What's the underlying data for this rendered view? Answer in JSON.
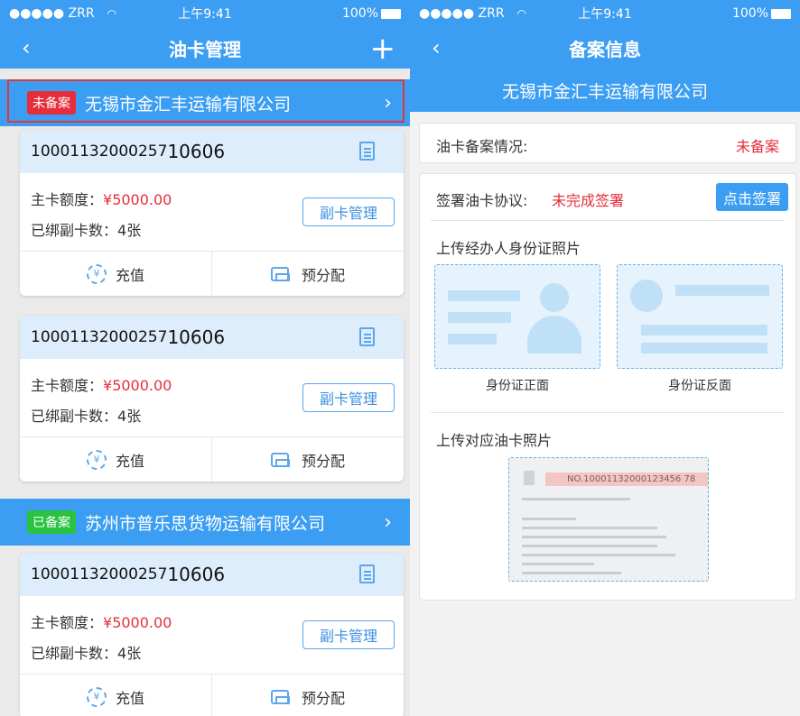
{
  "left_screen": {
    "status": {
      "carrier": "●●●●● ZRR",
      "time": "上午9:41",
      "battery": "100%"
    },
    "nav": {
      "back": "‹",
      "title": "油卡管理",
      "add": "+"
    },
    "groups": [
      {
        "badge": "未备案",
        "company": "无锡市金汇丰运输有限公司",
        "chevron": "›"
      },
      {
        "badge": "已备案",
        "company": "苏州市普乐思货物运输有限公司",
        "chevron": "›"
      }
    ],
    "cards": [
      {
        "number_prefix": "10001132000257",
        "number_suffix": "10606",
        "limit_label": "主卡额度：",
        "limit_value": "¥5000.00",
        "bound_label": "已绑副卡数：",
        "bound_value": "4张",
        "sub_button": "副卡管理",
        "recharge": "充值",
        "allocate": "预分配"
      },
      {
        "number_prefix": "10001132000257",
        "number_suffix": "10606",
        "limit_label": "主卡额度：",
        "limit_value": "¥5000.00",
        "bound_label": "已绑副卡数：",
        "bound_value": "4张",
        "sub_button": "副卡管理",
        "recharge": "充值",
        "allocate": "预分配"
      },
      {
        "number_prefix": "10001132000257",
        "number_suffix": "10606",
        "limit_label": "主卡额度：",
        "limit_value": "¥5000.00",
        "bound_label": "已绑副卡数：",
        "bound_value": "4张",
        "sub_button": "副卡管理",
        "recharge": "充值",
        "allocate": "预分配"
      }
    ]
  },
  "right_screen": {
    "status": {
      "carrier": "●●●●● ZRR",
      "time": "上午9:41",
      "battery": "100%"
    },
    "nav": {
      "back": "‹",
      "title": "备案信息"
    },
    "company": "无锡市金汇丰运输有限公司",
    "filing_label": "油卡备案情况:",
    "filing_value": "未备案",
    "agreement_label": "签署油卡协议:",
    "agreement_value": "未完成签署",
    "sign_button": "点击签署",
    "id_section_title": "上传经办人身份证照片",
    "id_front": "身份证正面",
    "id_back": "身份证反面",
    "oil_section_title": "上传对应油卡照片",
    "oil_card_number": "NO.10001132000123456 78"
  },
  "colors": {
    "primary": "#3c9ef2",
    "danger": "#e62e3a",
    "success": "#29c241"
  }
}
